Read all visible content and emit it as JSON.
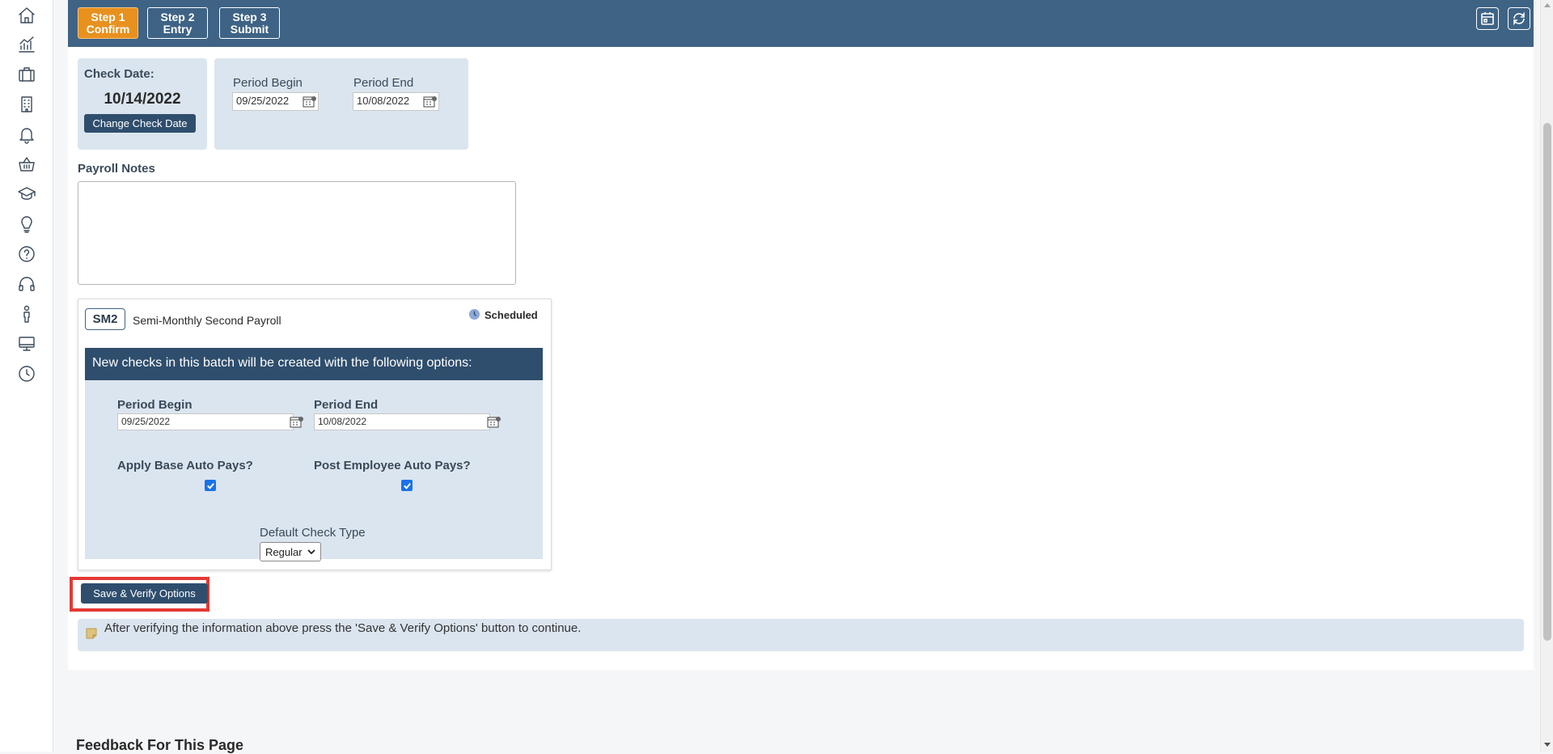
{
  "steps": [
    {
      "line1": "Step 1",
      "line2": "Confirm"
    },
    {
      "line1": "Step 2",
      "line2": "Entry"
    },
    {
      "line1": "Step 3",
      "line2": "Submit"
    }
  ],
  "check_date": {
    "label": "Check Date:",
    "value": "10/14/2022",
    "button": "Change Check Date"
  },
  "period": {
    "begin_label": "Period Begin",
    "begin_value": "09/25/2022",
    "end_label": "Period End",
    "end_value": "10/08/2022"
  },
  "notes": {
    "label": "Payroll Notes"
  },
  "batch": {
    "code": "SM2",
    "name": "Semi-Monthly Second Payroll",
    "status": "Scheduled",
    "header": "New checks in this batch will be created with the following options:",
    "period_begin_label": "Period Begin",
    "period_begin_value": "09/25/2022",
    "period_end_label": "Period End",
    "period_end_value": "10/08/2022",
    "apply_base_label": "Apply Base Auto Pays?",
    "post_employee_label": "Post Employee Auto Pays?",
    "check_type_label": "Default Check Type",
    "check_type_value": "Regular"
  },
  "save_button": "Save & Verify Options",
  "info_text": "After verifying the information above press the 'Save & Verify Options' button to continue.",
  "feedback_title": "Feedback For This Page",
  "colors": {
    "topbar": "#3e6385",
    "active_step": "#e8911f",
    "dark_button": "#2f4e6d",
    "panel": "#dbe5ef",
    "highlight": "#e53935"
  }
}
